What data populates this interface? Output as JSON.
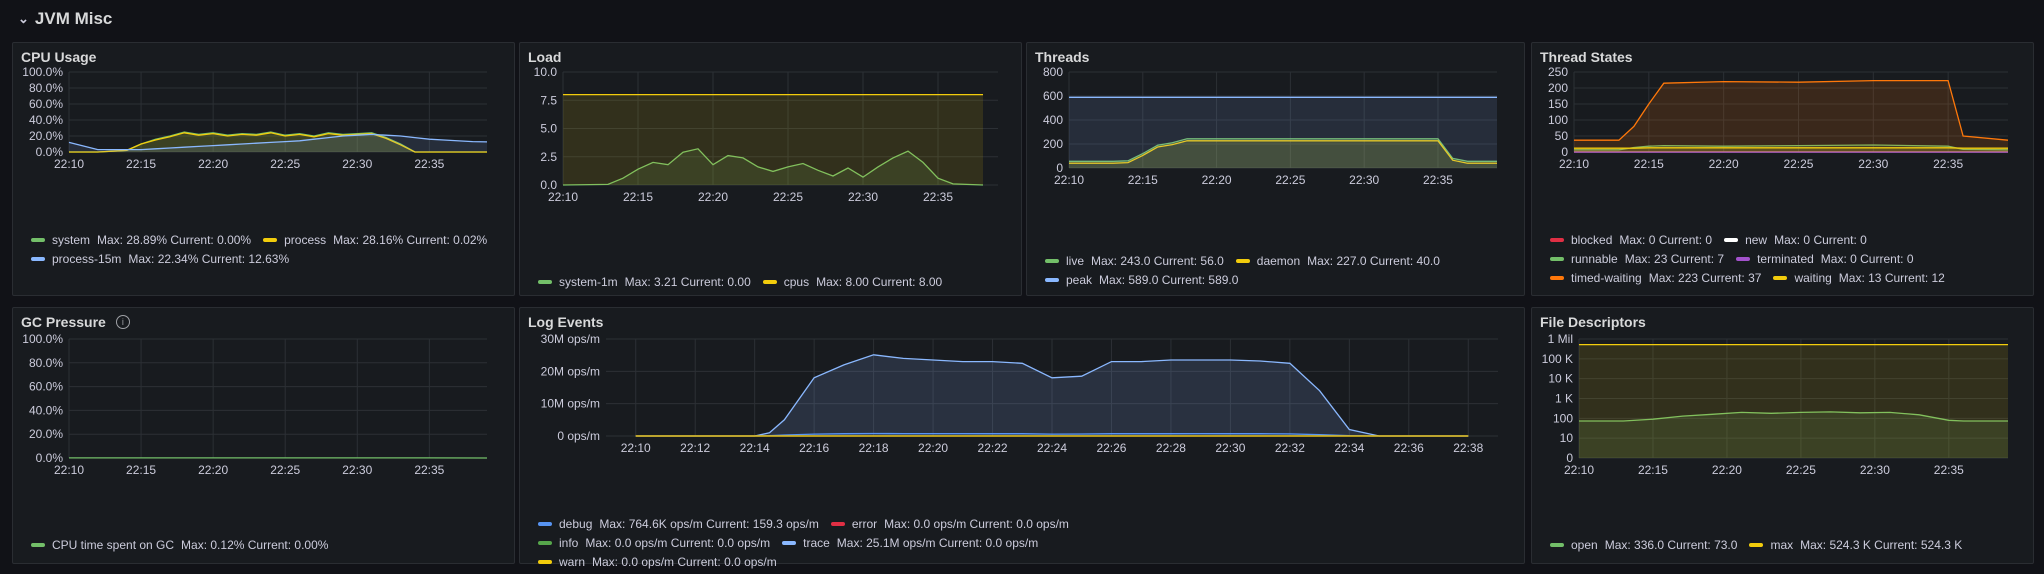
{
  "row": {
    "title": "JVM Misc"
  },
  "panels": {
    "cpu": {
      "title": "CPU Usage",
      "yticks": [
        "0.0%",
        "20.0%",
        "40.0%",
        "60.0%",
        "80.0%",
        "100.0%"
      ],
      "xticks": [
        "22:10",
        "22:15",
        "22:20",
        "22:25",
        "22:30",
        "22:35"
      ],
      "legend": [
        {
          "name": "system",
          "stats": "Max: 28.89%  Current: 0.00%",
          "color": "#73bf69"
        },
        {
          "name": "process",
          "stats": "Max: 28.16%  Current: 0.02%",
          "color": "#f2cc0c"
        },
        {
          "name": "process-15m",
          "stats": "Max: 22.34%  Current: 12.63%",
          "color": "#8ab8ff"
        }
      ]
    },
    "load": {
      "title": "Load",
      "yticks": [
        "0.0",
        "2.5",
        "5.0",
        "7.5",
        "10.0"
      ],
      "xticks": [
        "22:10",
        "22:15",
        "22:20",
        "22:25",
        "22:30",
        "22:35"
      ],
      "legend": [
        {
          "name": "system-1m",
          "stats": "Max: 3.21  Current: 0.00",
          "color": "#73bf69"
        },
        {
          "name": "cpus",
          "stats": "Max: 8.00  Current: 8.00",
          "color": "#f2cc0c"
        }
      ]
    },
    "threads": {
      "title": "Threads",
      "yticks": [
        "0",
        "200",
        "400",
        "600",
        "800"
      ],
      "xticks": [
        "22:10",
        "22:15",
        "22:20",
        "22:25",
        "22:30",
        "22:35"
      ],
      "legend": [
        {
          "name": "live",
          "stats": "Max: 243.0  Current: 56.0",
          "color": "#73bf69"
        },
        {
          "name": "daemon",
          "stats": "Max: 227.0  Current: 40.0",
          "color": "#f2cc0c"
        },
        {
          "name": "peak",
          "stats": "Max: 589.0  Current: 589.0",
          "color": "#8ab8ff"
        }
      ]
    },
    "thread_states": {
      "title": "Thread States",
      "yticks": [
        "0",
        "50",
        "100",
        "150",
        "200",
        "250"
      ],
      "xticks": [
        "22:10",
        "22:15",
        "22:20",
        "22:25",
        "22:30",
        "22:35"
      ],
      "legend": [
        {
          "name": "blocked",
          "stats": "Max: 0  Current: 0",
          "color": "#e02f44"
        },
        {
          "name": "new",
          "stats": "Max: 0  Current: 0",
          "color": "#ffffff"
        },
        {
          "name": "runnable",
          "stats": "Max: 23  Current: 7",
          "color": "#73bf69"
        },
        {
          "name": "terminated",
          "stats": "Max: 0  Current: 0",
          "color": "#a352cc"
        },
        {
          "name": "timed-waiting",
          "stats": "Max: 223  Current: 37",
          "color": "#ff780a"
        },
        {
          "name": "waiting",
          "stats": "Max: 13  Current: 12",
          "color": "#f2cc0c"
        }
      ]
    },
    "gc": {
      "title": "GC Pressure",
      "info_icon": "info-icon",
      "yticks": [
        "0.0%",
        "20.0%",
        "40.0%",
        "60.0%",
        "80.0%",
        "100.0%"
      ],
      "xticks": [
        "22:10",
        "22:15",
        "22:20",
        "22:25",
        "22:30",
        "22:35"
      ],
      "legend": [
        {
          "name": "CPU time spent on GC",
          "stats": "Max: 0.12%  Current: 0.00%",
          "color": "#73bf69"
        }
      ]
    },
    "log": {
      "title": "Log Events",
      "yticks": [
        "0 ops/m",
        "10M ops/m",
        "20M ops/m",
        "30M ops/m"
      ],
      "xticks": [
        "22:10",
        "22:12",
        "22:14",
        "22:16",
        "22:18",
        "22:20",
        "22:22",
        "22:24",
        "22:26",
        "22:28",
        "22:30",
        "22:32",
        "22:34",
        "22:36",
        "22:38"
      ],
      "legend": [
        {
          "name": "debug",
          "stats": "Max: 764.6K ops/m  Current: 159.3 ops/m",
          "color": "#5794f2"
        },
        {
          "name": "error",
          "stats": "Max: 0.0 ops/m  Current: 0.0 ops/m",
          "color": "#e02f44"
        },
        {
          "name": "info",
          "stats": "Max: 0.0 ops/m  Current: 0.0 ops/m",
          "color": "#56a64b"
        },
        {
          "name": "trace",
          "stats": "Max: 25.1M ops/m  Current: 0.0 ops/m",
          "color": "#8ab8ff"
        },
        {
          "name": "warn",
          "stats": "Max: 0.0 ops/m  Current: 0.0 ops/m",
          "color": "#f2cc0c"
        }
      ]
    },
    "fd": {
      "title": "File Descriptors",
      "yticks": [
        "0",
        "10",
        "100",
        "1 K",
        "10 K",
        "100 K",
        "1 Mil"
      ],
      "xticks": [
        "22:10",
        "22:15",
        "22:20",
        "22:25",
        "22:30",
        "22:35"
      ],
      "legend": [
        {
          "name": "open",
          "stats": "Max: 336.0  Current: 73.0",
          "color": "#73bf69"
        },
        {
          "name": "max",
          "stats": "Max: 524.3 K  Current: 524.3 K",
          "color": "#f2cc0c"
        }
      ]
    }
  },
  "chart_data": [
    {
      "type": "line",
      "title": "CPU Usage",
      "ylim": [
        0,
        100
      ],
      "unit": "%",
      "x": [
        "22:09",
        "22:12",
        "22:14",
        "22:15",
        "22:16",
        "22:17",
        "22:18",
        "22:19",
        "22:20",
        "22:21",
        "22:22",
        "22:23",
        "22:24",
        "22:25",
        "22:26",
        "22:27",
        "22:28",
        "22:29",
        "22:30",
        "22:31",
        "22:32",
        "22:33",
        "22:34",
        "22:35",
        "22:36",
        "22:38",
        "22:39"
      ],
      "series": [
        {
          "name": "system",
          "values": [
            0,
            0,
            2,
            10,
            16,
            20,
            25,
            22,
            24,
            21,
            23,
            22,
            25,
            21,
            23,
            20,
            24,
            22,
            23,
            24,
            18,
            10,
            0,
            0,
            0,
            0,
            0
          ]
        },
        {
          "name": "process",
          "values": [
            0,
            0,
            2,
            10,
            15,
            19,
            24,
            21,
            23,
            20,
            22,
            21,
            24,
            20,
            22,
            19,
            23,
            21,
            22,
            23,
            17,
            9,
            0,
            0,
            0,
            0,
            0
          ]
        },
        {
          "name": "process-15m",
          "values": [
            12,
            3,
            3,
            3,
            4,
            5,
            6,
            7,
            8,
            9,
            10,
            11,
            12,
            13,
            14,
            16,
            18,
            20,
            21,
            22,
            21,
            20,
            18,
            16,
            15,
            13,
            12.6
          ]
        }
      ]
    },
    {
      "type": "line",
      "title": "Load",
      "ylim": [
        0,
        10
      ],
      "x": [
        "22:09",
        "22:13",
        "22:14",
        "22:15",
        "22:16",
        "22:17",
        "22:18",
        "22:19",
        "22:20",
        "22:21",
        "22:22",
        "22:23",
        "22:24",
        "22:25",
        "22:26",
        "22:27",
        "22:28",
        "22:29",
        "22:30",
        "22:31",
        "22:32",
        "22:33",
        "22:34",
        "22:35",
        "22:36",
        "22:38"
      ],
      "series": [
        {
          "name": "system-1m",
          "values": [
            0,
            0.05,
            0.6,
            1.4,
            2.0,
            1.8,
            2.9,
            3.2,
            1.8,
            2.6,
            2.4,
            1.6,
            1.2,
            1.6,
            1.9,
            1.3,
            0.8,
            1.5,
            0.7,
            1.6,
            2.4,
            3.0,
            2.0,
            0.6,
            0.1,
            0
          ]
        },
        {
          "name": "cpus",
          "values": [
            8,
            8,
            8,
            8,
            8,
            8,
            8,
            8,
            8,
            8,
            8,
            8,
            8,
            8,
            8,
            8,
            8,
            8,
            8,
            8,
            8,
            8,
            8,
            8,
            8,
            8
          ]
        }
      ]
    },
    {
      "type": "line",
      "title": "Threads",
      "ylim": [
        0,
        800
      ],
      "x": [
        "22:09",
        "22:13",
        "22:14",
        "22:15",
        "22:16",
        "22:17",
        "22:18",
        "22:35",
        "22:36",
        "22:37",
        "22:39"
      ],
      "series": [
        {
          "name": "live",
          "values": [
            56,
            56,
            60,
            120,
            190,
            210,
            243,
            243,
            80,
            56,
            56
          ]
        },
        {
          "name": "daemon",
          "values": [
            40,
            40,
            45,
            105,
            175,
            195,
            227,
            227,
            65,
            40,
            40
          ]
        },
        {
          "name": "peak",
          "values": [
            589,
            589,
            589,
            589,
            589,
            589,
            589,
            589,
            589,
            589,
            589
          ]
        }
      ]
    },
    {
      "type": "line",
      "title": "Thread States",
      "ylim": [
        0,
        250
      ],
      "x": [
        "22:09",
        "22:13",
        "22:14",
        "22:15",
        "22:16",
        "22:20",
        "22:25",
        "22:30",
        "22:35",
        "22:36",
        "22:39"
      ],
      "series": [
        {
          "name": "blocked",
          "values": [
            0,
            0,
            0,
            0,
            0,
            0,
            0,
            0,
            0,
            0,
            0
          ]
        },
        {
          "name": "new",
          "values": [
            0,
            0,
            0,
            0,
            0,
            0,
            0,
            0,
            0,
            0,
            0
          ]
        },
        {
          "name": "runnable",
          "values": [
            7,
            7,
            14,
            18,
            20,
            18,
            20,
            22,
            18,
            8,
            7
          ]
        },
        {
          "name": "terminated",
          "values": [
            0,
            0,
            0,
            0,
            0,
            0,
            0,
            0,
            0,
            0,
            0
          ]
        },
        {
          "name": "timed-waiting",
          "values": [
            37,
            37,
            80,
            150,
            215,
            220,
            218,
            223,
            223,
            50,
            37
          ]
        },
        {
          "name": "waiting",
          "values": [
            12,
            12,
            12,
            13,
            13,
            13,
            13,
            13,
            13,
            12,
            12
          ]
        }
      ]
    },
    {
      "type": "line",
      "title": "GC Pressure",
      "ylim": [
        0,
        100
      ],
      "unit": "%",
      "x": [
        "22:09",
        "22:15",
        "22:20",
        "22:25",
        "22:30",
        "22:35",
        "22:39"
      ],
      "series": [
        {
          "name": "CPU time spent on GC",
          "values": [
            0.05,
            0.1,
            0.12,
            0.08,
            0.1,
            0.05,
            0
          ]
        }
      ]
    },
    {
      "type": "area",
      "title": "Log Events",
      "ylim": [
        0,
        30000000
      ],
      "unit": "ops/m",
      "x": [
        "22:10",
        "22:14",
        "22:14:30",
        "22:15",
        "22:16",
        "22:17",
        "22:18",
        "22:19",
        "22:20",
        "22:21",
        "22:22",
        "22:23",
        "22:24",
        "22:25",
        "22:26",
        "22:27",
        "22:28",
        "22:29",
        "22:30",
        "22:31",
        "22:32",
        "22:33",
        "22:34",
        "22:35",
        "22:38"
      ],
      "series": [
        {
          "name": "trace",
          "values": [
            0,
            0,
            1000000,
            5000000,
            18000000,
            22000000,
            25100000,
            24000000,
            23500000,
            23000000,
            23000000,
            22500000,
            18000000,
            18500000,
            23000000,
            23000000,
            23500000,
            23500000,
            23500000,
            23200000,
            22500000,
            14000000,
            2000000,
            0,
            0
          ]
        },
        {
          "name": "debug",
          "values": [
            0,
            0,
            100000,
            300000,
            600000,
            700000,
            764600,
            750000,
            740000,
            730000,
            720000,
            700000,
            600000,
            620000,
            700000,
            710000,
            720000,
            730000,
            720000,
            700000,
            650000,
            400000,
            100000,
            159.3,
            159.3
          ]
        },
        {
          "name": "error",
          "values": [
            0,
            0,
            0,
            0,
            0,
            0,
            0,
            0,
            0,
            0,
            0,
            0,
            0,
            0,
            0,
            0,
            0,
            0,
            0,
            0,
            0,
            0,
            0,
            0,
            0
          ]
        },
        {
          "name": "info",
          "values": [
            0,
            0,
            0,
            0,
            0,
            0,
            0,
            0,
            0,
            0,
            0,
            0,
            0,
            0,
            0,
            0,
            0,
            0,
            0,
            0,
            0,
            0,
            0,
            0,
            0
          ]
        },
        {
          "name": "warn",
          "values": [
            0,
            0,
            0,
            0,
            0,
            0,
            0,
            0,
            0,
            0,
            0,
            0,
            0,
            0,
            0,
            0,
            0,
            0,
            0,
            0,
            0,
            0,
            0,
            0,
            0
          ]
        }
      ]
    },
    {
      "type": "line",
      "title": "File Descriptors",
      "yscale": "log",
      "x": [
        "22:09",
        "22:13",
        "22:15",
        "22:17",
        "22:19",
        "22:21",
        "22:23",
        "22:25",
        "22:27",
        "22:29",
        "22:31",
        "22:33",
        "22:35",
        "22:36",
        "22:39"
      ],
      "series": [
        {
          "name": "open",
          "values": [
            73,
            73,
            90,
            130,
            160,
            200,
            180,
            200,
            210,
            190,
            200,
            150,
            80,
            73,
            73
          ]
        },
        {
          "name": "max",
          "values": [
            524300,
            524300,
            524300,
            524300,
            524300,
            524300,
            524300,
            524300,
            524300,
            524300,
            524300,
            524300,
            524300,
            524300,
            524300
          ]
        }
      ]
    }
  ]
}
